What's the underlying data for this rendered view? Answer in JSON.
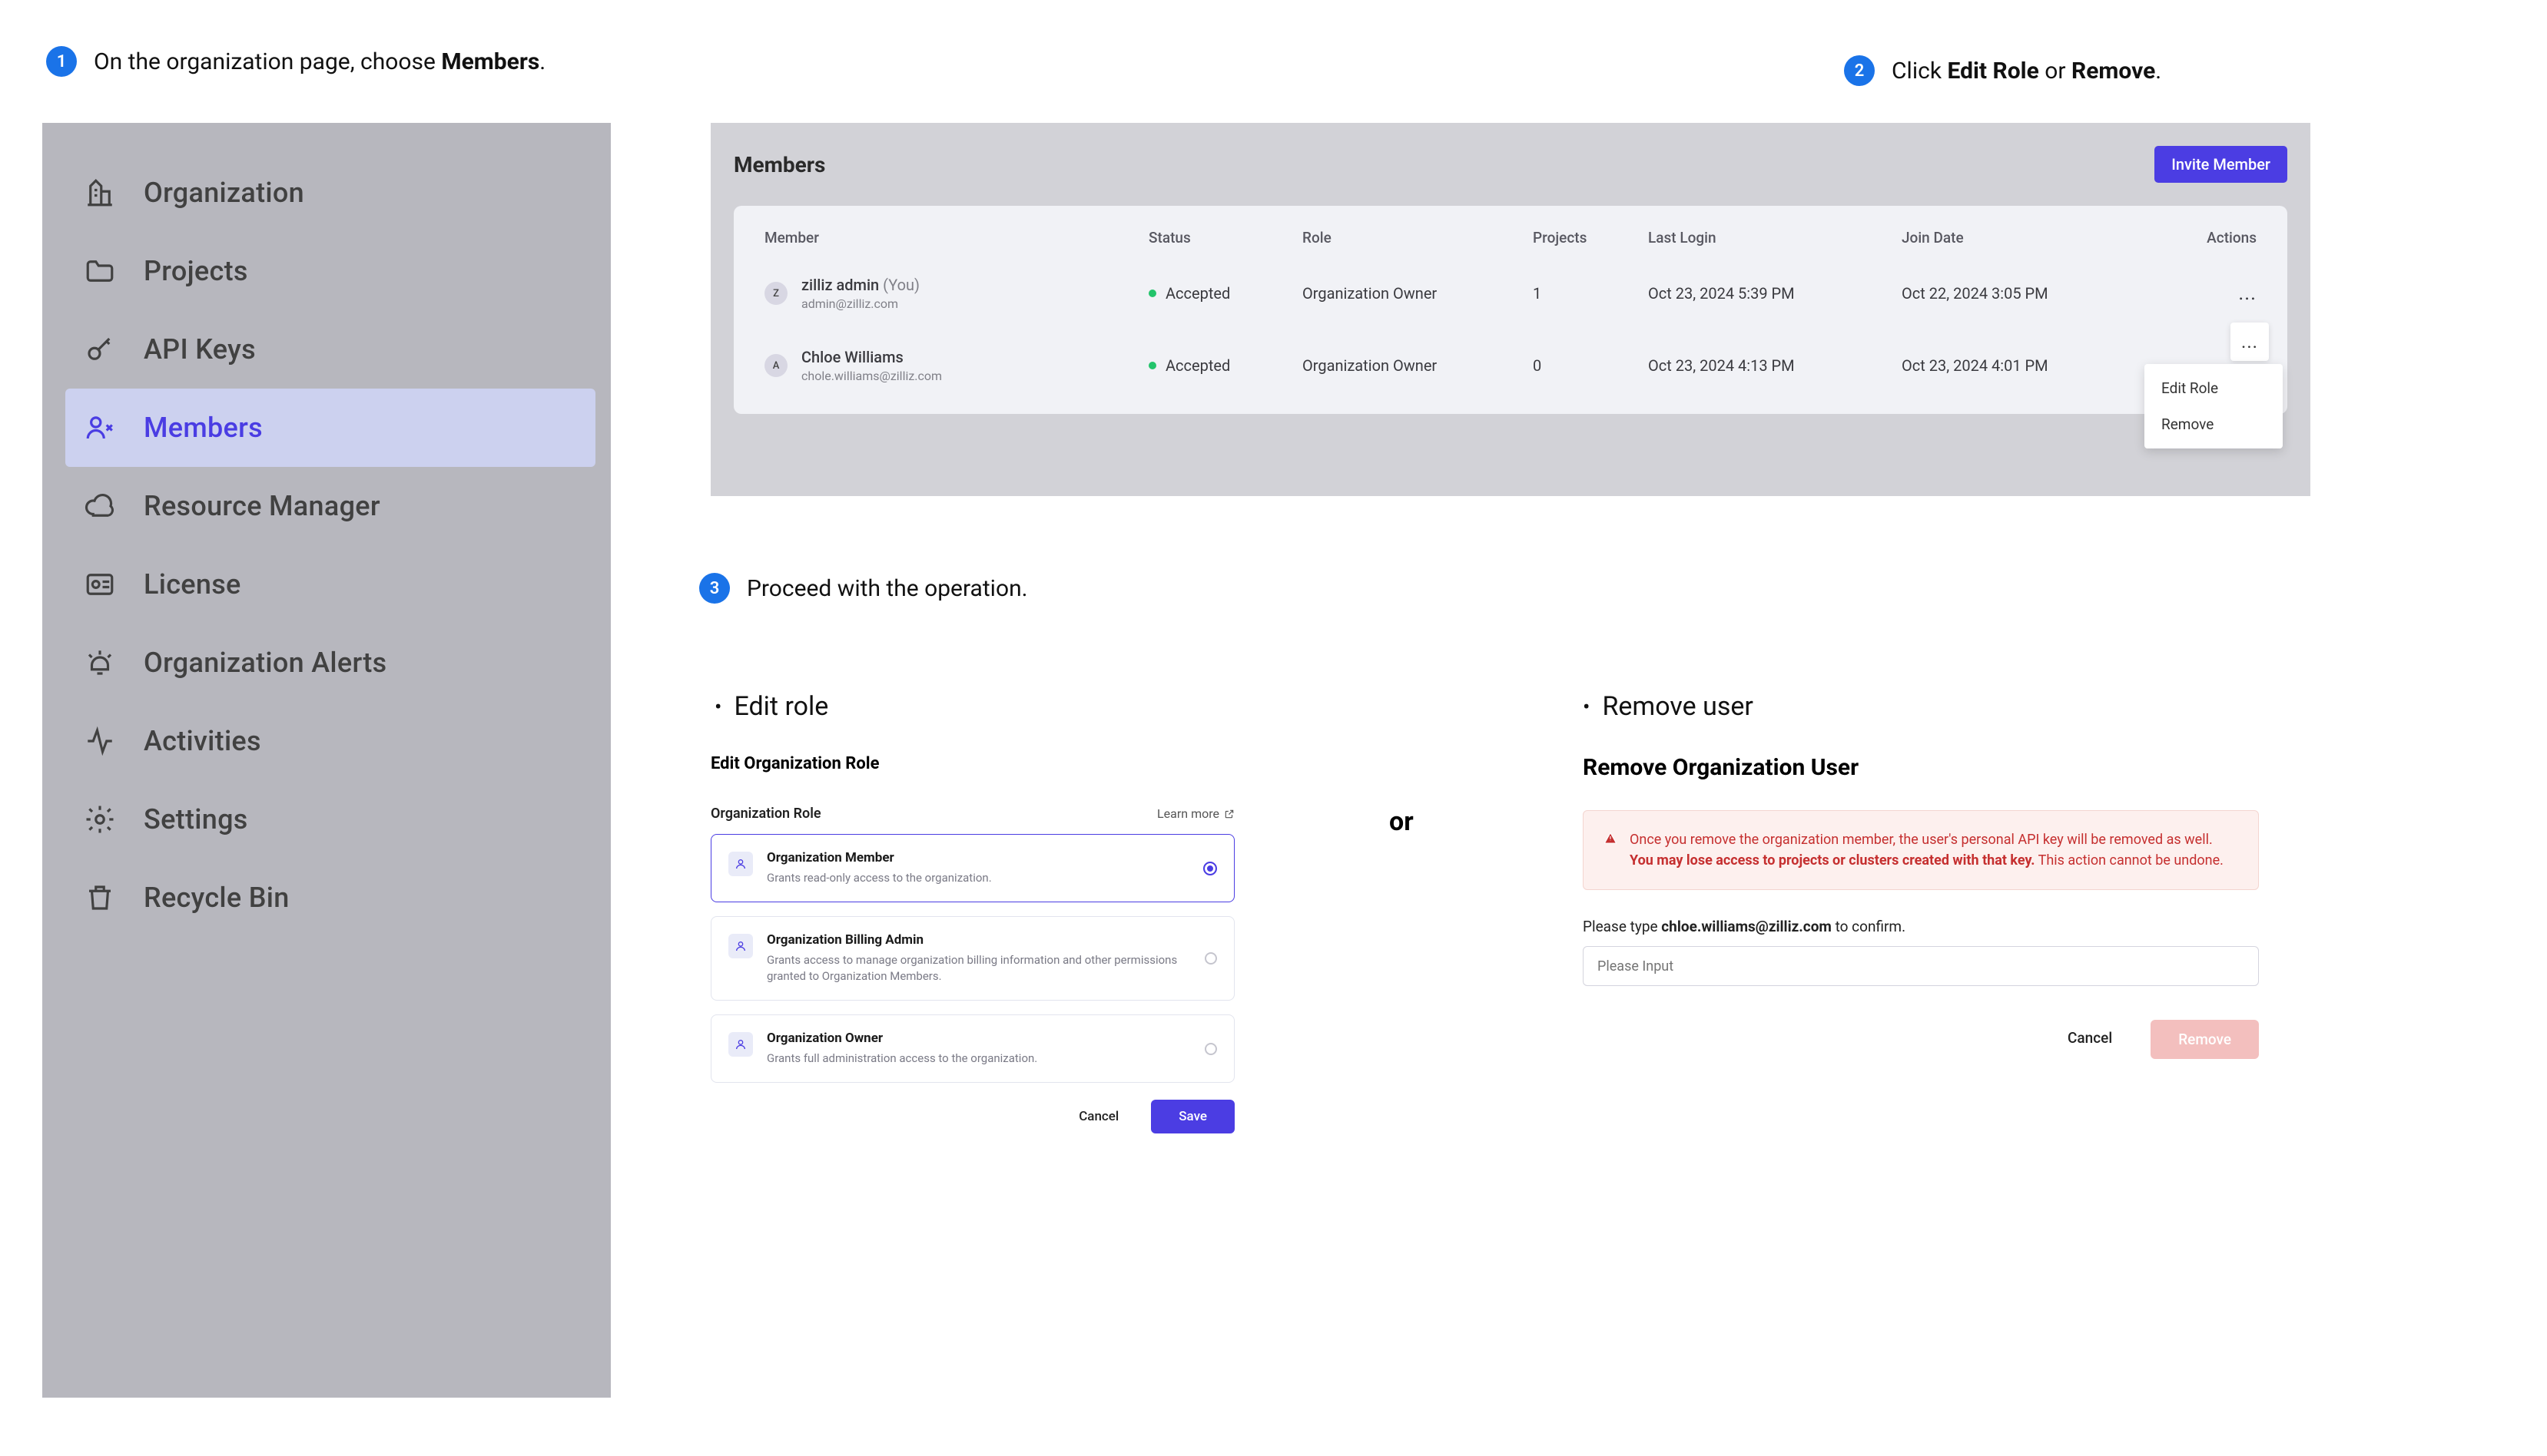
{
  "step1": {
    "num": "1",
    "text_a": "On the organization page, choose ",
    "text_b": "Members",
    "text_c": "."
  },
  "step2": {
    "num": "2",
    "text_a": "Click ",
    "b1": "Edit Role",
    "mid": " or ",
    "b2": "Remove",
    "text_c": "."
  },
  "step3": {
    "num": "3",
    "text": "Proceed with the operation."
  },
  "sidebar": {
    "items": [
      {
        "label": "Organization"
      },
      {
        "label": "Projects"
      },
      {
        "label": "API Keys"
      },
      {
        "label": "Members"
      },
      {
        "label": "Resource Manager"
      },
      {
        "label": "License"
      },
      {
        "label": "Organization Alerts"
      },
      {
        "label": "Activities"
      },
      {
        "label": "Settings"
      },
      {
        "label": "Recycle Bin"
      }
    ]
  },
  "members": {
    "title": "Members",
    "invite": "Invite Member",
    "cols": {
      "member": "Member",
      "status": "Status",
      "role": "Role",
      "projects": "Projects",
      "last_login": "Last Login",
      "join_date": "Join Date",
      "actions": "Actions"
    },
    "rows": [
      {
        "initial": "Z",
        "name": "zilliz admin",
        "you": "(You)",
        "email": "admin@zilliz.com",
        "status": "Accepted",
        "role": "Organization Owner",
        "projects": "1",
        "last_login": "Oct 23, 2024 5:39 PM",
        "join_date": "Oct 22, 2024 3:05 PM",
        "dots": "..."
      },
      {
        "initial": "A",
        "name": "Chloe Williams",
        "you": "",
        "email": "chole.williams@zilliz.com",
        "status": "Accepted",
        "role": "Organization Owner",
        "projects": "0",
        "last_login": "Oct 23, 2024 4:13 PM",
        "join_date": "Oct 23, 2024 4:01 PM",
        "dots": "..."
      }
    ],
    "menu": {
      "edit": "Edit Role",
      "remove": "Remove"
    }
  },
  "edit_bullet": "Edit role",
  "remove_bullet": "Remove user",
  "or": "or",
  "edit_dlg": {
    "title": "Edit Organization Role",
    "section": "Organization Role",
    "learn": "Learn more",
    "opts": [
      {
        "name": "Organization Member",
        "desc": "Grants read-only access to the organization."
      },
      {
        "name": "Organization Billing Admin",
        "desc": "Grants access to manage organization billing information and other permissions granted to Organization Members."
      },
      {
        "name": "Organization Owner",
        "desc": "Grants full administration access to the organization."
      }
    ],
    "cancel": "Cancel",
    "save": "Save"
  },
  "remove_dlg": {
    "title": "Remove Organization User",
    "warn_a": "Once you remove the organization member, the user's personal API key will be removed as well. ",
    "warn_b": "You may lose access to projects or clusters created with that key.",
    "warn_c": " This action cannot be undone.",
    "confirm_a": "Please type ",
    "confirm_email": "chloe.williams@zilliz.com",
    "confirm_b": " to confirm.",
    "placeholder": "Please Input",
    "cancel": "Cancel",
    "remove": "Remove"
  }
}
